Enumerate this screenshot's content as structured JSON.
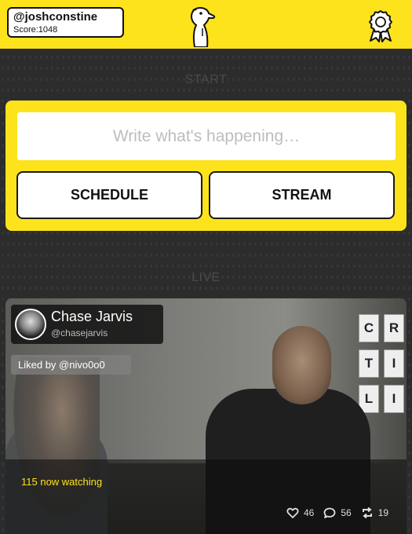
{
  "user": {
    "handle": "@joshconstine",
    "score": "Score:1048"
  },
  "sections": {
    "start": "START",
    "live": "LIVE"
  },
  "composer": {
    "placeholder": "Write what's happening…",
    "schedule_label": "SCHEDULE",
    "stream_label": "STREAM"
  },
  "live_stream": {
    "host_name": "Chase Jarvis",
    "host_handle": "@chasejarvis",
    "liked_by": "Liked by @nivo0o0",
    "watching": "115 now watching",
    "likes": "46",
    "comments": "56",
    "restreams": "19",
    "tiles": [
      "C",
      "R",
      "T",
      "I",
      "L",
      "I"
    ]
  },
  "colors": {
    "accent": "#fde31c",
    "background": "#2c2c2c"
  },
  "icons": [
    "meerkat-logo-icon",
    "ribbon-badge-icon",
    "heart-icon",
    "comment-icon",
    "restream-icon"
  ]
}
